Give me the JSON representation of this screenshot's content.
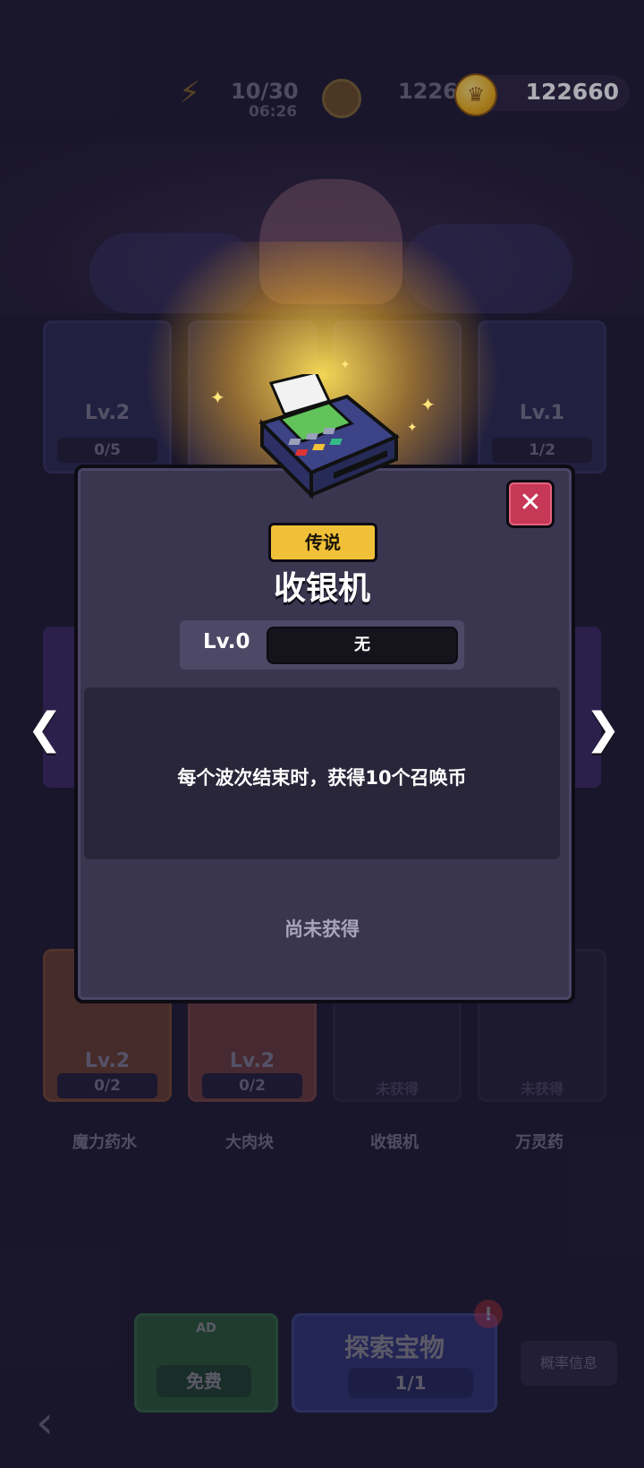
{
  "resources": {
    "energy": "10/30",
    "energy_timer": "06:26",
    "crowns": "1226",
    "gold": "122660"
  },
  "cards_top": [
    {
      "level": "Lv.2",
      "count": "0/5"
    },
    {
      "level": "Lv.1",
      "count": "1/2"
    }
  ],
  "cards_bottom": [
    {
      "level": "Lv.2",
      "count": "0/2",
      "name": "魔力药水"
    },
    {
      "level": "Lv.2",
      "count": "0/2",
      "name": "大肉块"
    },
    {
      "level": "",
      "count": "未获得",
      "name": "收银机"
    },
    {
      "level": "",
      "count": "未获得",
      "name": "万灵药"
    }
  ],
  "bottom": {
    "ad_label": "AD",
    "free_label": "免费",
    "explore_title": "探索宝物",
    "explore_count": "1/1",
    "explore_alert": "!",
    "prob_label": "概率信息",
    "back": "‹"
  },
  "modal": {
    "rarity": "传说",
    "title": "收银机",
    "level_label": "Lv.0",
    "level_value": "无",
    "description": "每个波次结束时，获得10个召唤币",
    "status": "尚未获得",
    "close_glyph": "✕",
    "prev_glyph": "❮",
    "next_glyph": "❯"
  },
  "colors": {
    "rarity_legend": "#f0c038",
    "close_red": "#c63856",
    "modal_bg": "#3a3650"
  }
}
